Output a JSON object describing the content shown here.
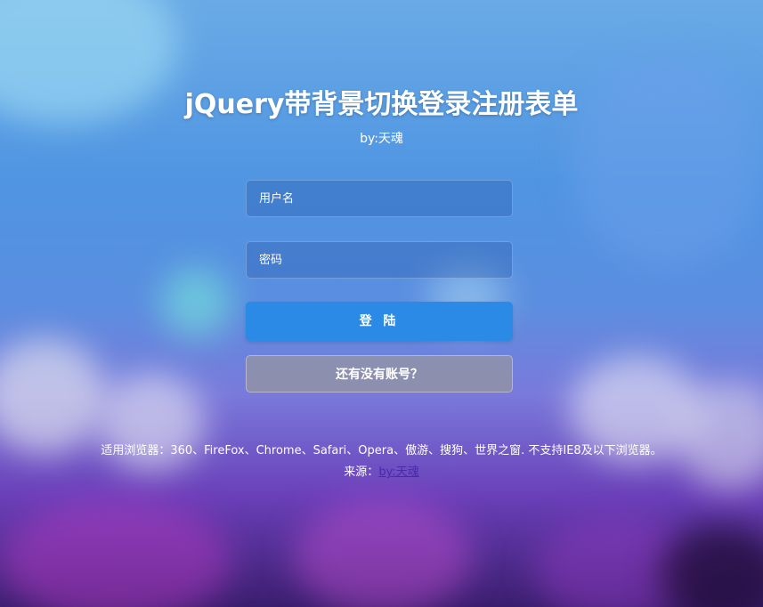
{
  "header": {
    "title": "jQuery带背景切换登录注册表单",
    "subtitle": "by:天魂"
  },
  "form": {
    "username_placeholder": "用户名",
    "password_placeholder": "密码",
    "login_label": "登 陆",
    "register_label": "还有没有账号？"
  },
  "footer": {
    "compat_text": "适用浏览器：360、FireFox、Chrome、Safari、Opera、傲游、搜狗、世界之窗. 不支持IE8及以下浏览器。",
    "source_prefix": "来源：",
    "source_link": "by:天魂"
  },
  "colors": {
    "login_button": "#2b8ae6",
    "register_button": "#96969f",
    "link": "#4a2aa8"
  }
}
